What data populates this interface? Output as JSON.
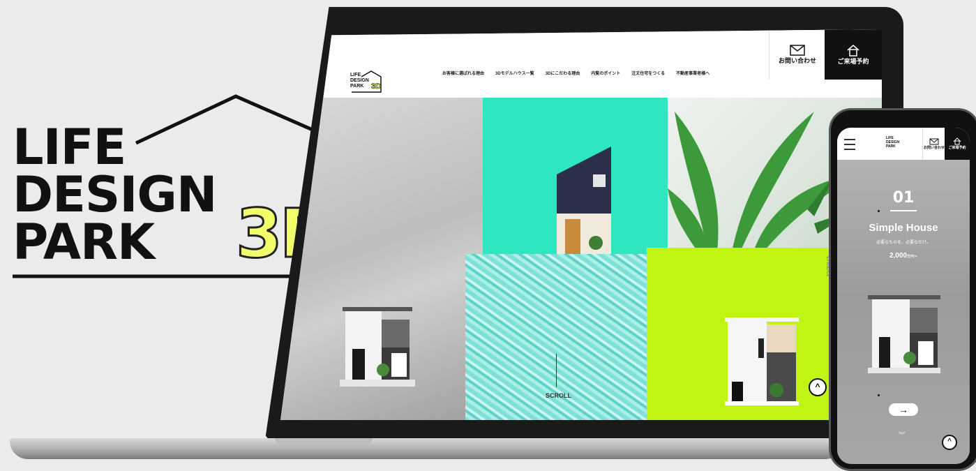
{
  "brand": {
    "line1": "LIFE",
    "line2": "DESIGN",
    "line3": "PARK",
    "accent": "3D",
    "accent_color": "#f0ff6a"
  },
  "site": {
    "logo_lines": [
      "LIFE",
      "DESIGN",
      "PARK"
    ],
    "logo_accent": "3D",
    "nav": [
      "お客様に選ばれる理由",
      "3Dモデルハウス一覧",
      "3Dにこだわる理由",
      "内覧のポイント",
      "注文住宅をつくる",
      "不動産事業者様へ"
    ],
    "contact_label": "お問い合わせ",
    "visit_label": "ご来場予約",
    "scroll_label": "SCROLL",
    "side_label": "chitect",
    "colors": {
      "teal": "#2ee6c0",
      "lime": "#bff413",
      "dark": "#111111"
    }
  },
  "phone": {
    "contact_label": "お問い合わせ",
    "visit_label": "ご来場予約",
    "number": "01",
    "title": "Simple House",
    "subtitle": "必要なものを、必要なだけ。",
    "price": "2,000",
    "price_unit": "万円〜",
    "arrow": "→",
    "chevron": "︾",
    "up": "^"
  }
}
